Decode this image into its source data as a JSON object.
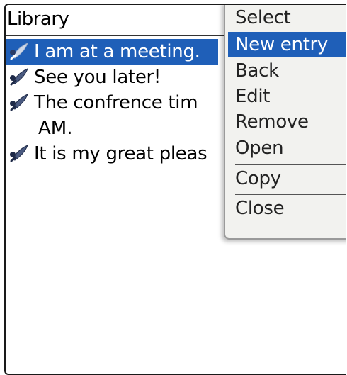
{
  "header": {
    "title": "Library"
  },
  "list": {
    "items": [
      {
        "label": "I am at a meeting.",
        "selected": true,
        "icon": "quill-pen-icon"
      },
      {
        "label": "See you later!",
        "selected": false,
        "icon": "quill-pen-icon"
      },
      {
        "label": "The confrence tim",
        "continuation": "AM.",
        "selected": false,
        "icon": "quill-pen-icon"
      },
      {
        "label": "It is my great pleas",
        "selected": false,
        "icon": "quill-pen-icon"
      }
    ]
  },
  "menu": {
    "items": [
      {
        "label": "Select"
      },
      {
        "label": "New entry",
        "highlighted": true
      },
      {
        "label": "Back"
      },
      {
        "label": "Edit"
      },
      {
        "label": "Remove"
      },
      {
        "label": "Open"
      },
      {
        "label": "Copy"
      },
      {
        "label": "Close"
      }
    ]
  },
  "colors": {
    "selection": "#1f5fb8",
    "menu_background": "#f2f2ef"
  }
}
